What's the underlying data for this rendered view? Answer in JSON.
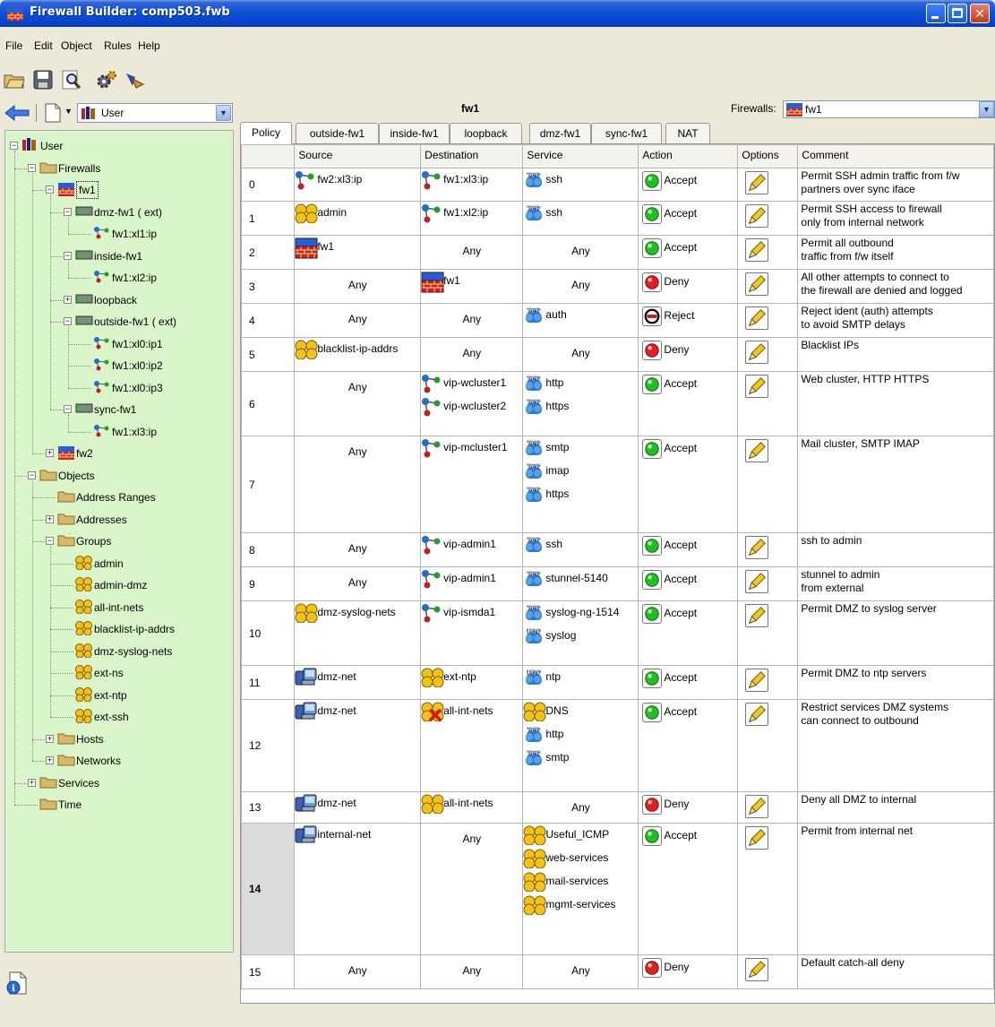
{
  "window": {
    "title": "Firewall Builder: comp503.fwb",
    "min_glyph": "_",
    "close_glyph": "✕"
  },
  "menu": [
    "File",
    "Edit",
    "Object",
    "Rules",
    "Help"
  ],
  "toolbar": {
    "icons": [
      "open-folder-icon",
      "save-disk-icon",
      "find-magnifier-icon",
      "compile-gears-icon",
      "install-icon"
    ]
  },
  "nav": {
    "library": "User"
  },
  "tree": {
    "nodes": [
      {
        "label": "User",
        "level": 0,
        "exp": "−",
        "icon": "library"
      },
      {
        "label": "Firewalls",
        "level": 1,
        "exp": "−",
        "icon": "folder"
      },
      {
        "label": "fw1",
        "level": 2,
        "exp": "−",
        "icon": "firewall",
        "selected": true
      },
      {
        "label": "dmz-fw1 ( ext)",
        "level": 3,
        "exp": "−",
        "icon": "iface"
      },
      {
        "label": "fw1:xl1:ip",
        "level": 4,
        "exp": "",
        "icon": "ip"
      },
      {
        "label": "inside-fw1",
        "level": 3,
        "exp": "−",
        "icon": "iface"
      },
      {
        "label": "fw1:xl2:ip",
        "level": 4,
        "exp": "",
        "icon": "ip"
      },
      {
        "label": "loopback",
        "level": 3,
        "exp": "+",
        "icon": "iface"
      },
      {
        "label": "outside-fw1 ( ext)",
        "level": 3,
        "exp": "−",
        "icon": "iface"
      },
      {
        "label": "fw1:xl0:ip1",
        "level": 4,
        "exp": "",
        "icon": "ip"
      },
      {
        "label": "fw1:xl0:ip2",
        "level": 4,
        "exp": "",
        "icon": "ip"
      },
      {
        "label": "fw1:xl0:ip3",
        "level": 4,
        "exp": "",
        "icon": "ip"
      },
      {
        "label": "sync-fw1",
        "level": 3,
        "exp": "−",
        "icon": "iface"
      },
      {
        "label": "fw1:xl3:ip",
        "level": 4,
        "exp": "",
        "icon": "ip"
      },
      {
        "label": "fw2",
        "level": 2,
        "exp": "+",
        "icon": "firewall"
      },
      {
        "label": "Objects",
        "level": 1,
        "exp": "−",
        "icon": "folder"
      },
      {
        "label": "Address Ranges",
        "level": 2,
        "exp": "",
        "icon": "folder"
      },
      {
        "label": "Addresses",
        "level": 2,
        "exp": "+",
        "icon": "folder"
      },
      {
        "label": "Groups",
        "level": 2,
        "exp": "−",
        "icon": "folder"
      },
      {
        "label": "admin",
        "level": 3,
        "exp": "",
        "icon": "group"
      },
      {
        "label": "admin-dmz",
        "level": 3,
        "exp": "",
        "icon": "group"
      },
      {
        "label": "all-int-nets",
        "level": 3,
        "exp": "",
        "icon": "group"
      },
      {
        "label": "blacklist-ip-addrs",
        "level": 3,
        "exp": "",
        "icon": "group"
      },
      {
        "label": "dmz-syslog-nets",
        "level": 3,
        "exp": "",
        "icon": "group"
      },
      {
        "label": "ext-ns",
        "level": 3,
        "exp": "",
        "icon": "group"
      },
      {
        "label": "ext-ntp",
        "level": 3,
        "exp": "",
        "icon": "group"
      },
      {
        "label": "ext-ssh",
        "level": 3,
        "exp": "",
        "icon": "group"
      },
      {
        "label": "Hosts",
        "level": 2,
        "exp": "+",
        "icon": "folder"
      },
      {
        "label": "Networks",
        "level": 2,
        "exp": "+",
        "icon": "folder"
      },
      {
        "label": "Services",
        "level": 1,
        "exp": "+",
        "icon": "folder"
      },
      {
        "label": "Time",
        "level": 1,
        "exp": "",
        "icon": "folder"
      }
    ]
  },
  "header": {
    "firewall_name": "fw1",
    "firewalls_label": "Firewalls:",
    "firewalls_value": "fw1"
  },
  "tabs": [
    "Policy",
    "outside-fw1",
    "inside-fw1",
    "loopback",
    "dmz-fw1",
    "sync-fw1",
    "NAT"
  ],
  "columns": [
    "",
    "Source",
    "Destination",
    "Service",
    "Action",
    "Options",
    "Comment"
  ],
  "rules": [
    {
      "n": "0",
      "src": [
        {
          "t": "fw2:xl3:ip",
          "i": "ip"
        }
      ],
      "dst": [
        {
          "t": "fw1:xl3:ip",
          "i": "ip"
        }
      ],
      "svc": [
        {
          "t": "ssh",
          "i": "tcp"
        }
      ],
      "action": "Accept",
      "comment": [
        "Permit SSH admin traffic from f/w",
        "partners over sync iface"
      ],
      "h": 37
    },
    {
      "n": "1",
      "src": [
        {
          "t": "admin",
          "i": "group"
        }
      ],
      "dst": [
        {
          "t": "fw1:xl2:ip",
          "i": "ip"
        }
      ],
      "svc": [
        {
          "t": "ssh",
          "i": "tcp"
        }
      ],
      "action": "Accept",
      "comment": [
        "Permit SSH access to firewall",
        "only from internal network"
      ],
      "h": 38
    },
    {
      "n": "2",
      "src": [
        {
          "t": "fw1",
          "i": "firewall"
        }
      ],
      "dst": [
        {
          "t": "Any",
          "i": "any"
        }
      ],
      "svc": [
        {
          "t": "Any",
          "i": "any"
        }
      ],
      "action": "Accept",
      "comment": [
        "Permit all outbound",
        "traffic from f/w itself"
      ],
      "h": 38
    },
    {
      "n": "3",
      "src": [
        {
          "t": "Any",
          "i": "any"
        }
      ],
      "dst": [
        {
          "t": "fw1",
          "i": "firewall"
        }
      ],
      "svc": [
        {
          "t": "Any",
          "i": "any"
        }
      ],
      "action": "Deny",
      "comment": [
        "All other attempts to connect to",
        "the firewall are denied and logged"
      ],
      "h": 38
    },
    {
      "n": "4",
      "src": [
        {
          "t": "Any",
          "i": "any"
        }
      ],
      "dst": [
        {
          "t": "Any",
          "i": "any"
        }
      ],
      "svc": [
        {
          "t": "auth",
          "i": "tcp"
        }
      ],
      "action": "Reject",
      "comment": [
        "Reject ident (auth)  attempts",
        "to avoid SMTP delays"
      ],
      "h": 38
    },
    {
      "n": "5",
      "src": [
        {
          "t": "blacklist-ip-addrs",
          "i": "group"
        }
      ],
      "dst": [
        {
          "t": "Any",
          "i": "any"
        }
      ],
      "svc": [
        {
          "t": "Any",
          "i": "any"
        }
      ],
      "action": "Deny",
      "comment": [
        "Blacklist IPs"
      ],
      "h": 38
    },
    {
      "n": "6",
      "src": [
        {
          "t": "Any",
          "i": "any"
        }
      ],
      "dst": [
        {
          "t": "vip-wcluster1",
          "i": "ip"
        },
        {
          "t": "vip-wcluster2",
          "i": "ip"
        }
      ],
      "svc": [
        {
          "t": "http",
          "i": "tcp"
        },
        {
          "t": "https",
          "i": "tcp"
        }
      ],
      "action": "Accept",
      "comment": [
        "Web cluster, HTTP HTTPS"
      ],
      "h": 72
    },
    {
      "n": "7",
      "src": [
        {
          "t": "Any",
          "i": "any"
        }
      ],
      "dst": [
        {
          "t": "vip-mcluster1",
          "i": "ip"
        }
      ],
      "svc": [
        {
          "t": "smtp",
          "i": "tcp"
        },
        {
          "t": "imap",
          "i": "tcp"
        },
        {
          "t": "https",
          "i": "tcp"
        }
      ],
      "action": "Accept",
      "comment": [
        "Mail cluster, SMTP IMAP"
      ],
      "h": 108
    },
    {
      "n": "8",
      "src": [
        {
          "t": "Any",
          "i": "any"
        }
      ],
      "dst": [
        {
          "t": "vip-admin1",
          "i": "ip"
        }
      ],
      "svc": [
        {
          "t": "ssh",
          "i": "tcp"
        }
      ],
      "action": "Accept",
      "comment": [
        "ssh to admin"
      ],
      "h": 38
    },
    {
      "n": "9",
      "src": [
        {
          "t": "Any",
          "i": "any"
        }
      ],
      "dst": [
        {
          "t": "vip-admin1",
          "i": "ip"
        }
      ],
      "svc": [
        {
          "t": "stunnel-5140",
          "i": "tcp"
        }
      ],
      "action": "Accept",
      "comment": [
        "stunnel to admin",
        "from external"
      ],
      "h": 38
    },
    {
      "n": "10",
      "src": [
        {
          "t": "dmz-syslog-nets",
          "i": "group"
        }
      ],
      "dst": [
        {
          "t": "vip-ismda1",
          "i": "ip"
        }
      ],
      "svc": [
        {
          "t": "syslog-ng-1514",
          "i": "tcp"
        },
        {
          "t": "syslog",
          "i": "udp"
        }
      ],
      "action": "Accept",
      "comment": [
        "Permit DMZ to syslog server"
      ],
      "h": 72
    },
    {
      "n": "11",
      "src": [
        {
          "t": "dmz-net",
          "i": "net"
        }
      ],
      "dst": [
        {
          "t": "ext-ntp",
          "i": "group"
        }
      ],
      "svc": [
        {
          "t": "ntp",
          "i": "udp"
        }
      ],
      "action": "Accept",
      "comment": [
        "Permit DMZ to ntp servers"
      ],
      "h": 38
    },
    {
      "n": "12",
      "src": [
        {
          "t": "dmz-net",
          "i": "net"
        }
      ],
      "dst": [
        {
          "t": "all-int-nets",
          "i": "groupneg"
        }
      ],
      "svc": [
        {
          "t": "DNS",
          "i": "group"
        },
        {
          "t": "http",
          "i": "tcp"
        },
        {
          "t": "smtp",
          "i": "tcp"
        }
      ],
      "action": "Accept",
      "comment": [
        "Restrict services DMZ systems",
        "can connect to outbound"
      ],
      "h": 103
    },
    {
      "n": "13",
      "src": [
        {
          "t": "dmz-net",
          "i": "net"
        }
      ],
      "dst": [
        {
          "t": "all-int-nets",
          "i": "group"
        }
      ],
      "svc": [
        {
          "t": "Any",
          "i": "any"
        }
      ],
      "action": "Deny",
      "comment": [
        "Deny all DMZ to internal"
      ],
      "h": 35
    },
    {
      "n": "14",
      "src": [
        {
          "t": "internal-net",
          "i": "net"
        }
      ],
      "dst": [
        {
          "t": "Any",
          "i": "any"
        }
      ],
      "svc": [
        {
          "t": "Useful_ICMP",
          "i": "group"
        },
        {
          "t": "web-services",
          "i": "group"
        },
        {
          "t": "mail-services",
          "i": "group"
        },
        {
          "t": "mgmt-services",
          "i": "group"
        }
      ],
      "action": "Accept",
      "comment": [
        "Permit from internal net"
      ],
      "h": 147,
      "selected": true
    },
    {
      "n": "15",
      "src": [
        {
          "t": "Any",
          "i": "any"
        }
      ],
      "dst": [
        {
          "t": "Any",
          "i": "any"
        }
      ],
      "svc": [
        {
          "t": "Any",
          "i": "any"
        }
      ],
      "action": "Deny",
      "comment": [
        "Default catch-all deny"
      ],
      "h": 38
    }
  ],
  "colors": {
    "tree_bg": "#d9f5c9",
    "accept": "#20c020",
    "deny": "#e02020"
  }
}
